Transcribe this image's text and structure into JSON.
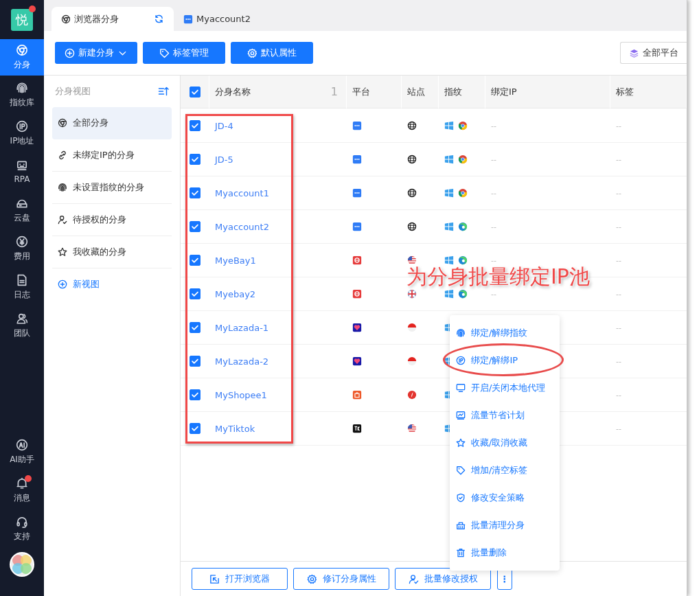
{
  "sidebar": {
    "logo": "悦",
    "logo_badge": true,
    "items": [
      {
        "label": "分身",
        "selected": true
      },
      {
        "label": "指纹库",
        "selected": false
      },
      {
        "label": "IP地址",
        "selected": false
      },
      {
        "label": "RPA",
        "selected": false
      },
      {
        "label": "云盘",
        "selected": false
      },
      {
        "label": "费用",
        "selected": false
      },
      {
        "label": "日志",
        "selected": false
      },
      {
        "label": "团队",
        "selected": false
      }
    ],
    "bottom_items": [
      {
        "label": "AI助手",
        "badge": false
      },
      {
        "label": "消息",
        "badge": true
      },
      {
        "label": "支持",
        "badge": false
      }
    ]
  },
  "tabs": [
    {
      "label": "浏览器分身",
      "selected": true,
      "refresh": true
    },
    {
      "label": "Myaccount2",
      "selected": false,
      "refresh": false
    }
  ],
  "toolbar": {
    "buttons": [
      {
        "label": "新建分身",
        "dropdown": true
      },
      {
        "label": "标签管理",
        "dropdown": false
      },
      {
        "label": "默认属性",
        "dropdown": false
      }
    ],
    "platform_filter": "全部平台"
  },
  "views": {
    "title": "分身视图",
    "items": [
      {
        "label": "全部分身",
        "selected": true
      },
      {
        "label": "未绑定IP的分身",
        "selected": false
      },
      {
        "label": "未设置指纹的分身",
        "selected": false
      },
      {
        "label": "待授权的分身",
        "selected": false
      },
      {
        "label": "我收藏的分身",
        "selected": false
      }
    ],
    "add_link": "新视图"
  },
  "table": {
    "all_checked": true,
    "columns": [
      {
        "label": "分身名称",
        "extra": "1"
      },
      {
        "label": "平台"
      },
      {
        "label": "站点"
      },
      {
        "label": "指纹"
      },
      {
        "label": "绑定IP"
      },
      {
        "label": "标签"
      }
    ],
    "rows": [
      {
        "checked": true,
        "name": "JD-4",
        "ip": "--",
        "tag": "--"
      },
      {
        "checked": true,
        "name": "JD-5",
        "ip": "--",
        "tag": "--"
      },
      {
        "checked": true,
        "name": "Myaccount1",
        "ip": "--",
        "tag": "--"
      },
      {
        "checked": true,
        "name": "Myaccount2",
        "ip": "--",
        "tag": "--"
      },
      {
        "checked": true,
        "name": "MyeBay1",
        "ip": "--",
        "tag": "--"
      },
      {
        "checked": true,
        "name": "Myebay2",
        "ip": "--",
        "tag": "--"
      },
      {
        "checked": true,
        "name": "MyLazada-1",
        "tag": "--"
      },
      {
        "checked": true,
        "name": "MyLazada-2",
        "tag": "--"
      },
      {
        "checked": true,
        "name": "MyShopee1",
        "tag": "--"
      },
      {
        "checked": true,
        "name": "MyTiktok",
        "tag": "--"
      }
    ]
  },
  "context_menu": {
    "items": [
      {
        "label": "绑定/解绑指纹",
        "highlighted": false
      },
      {
        "label": "绑定/解绑IP",
        "highlighted": true
      },
      {
        "label": "开启/关闭本地代理",
        "highlighted": false
      },
      {
        "label": "流量节省计划",
        "highlighted": false
      },
      {
        "label": "收藏/取消收藏",
        "highlighted": false
      },
      {
        "label": "增加/清空标签",
        "highlighted": false
      },
      {
        "label": "修改安全策略",
        "highlighted": false
      },
      {
        "label": "批量清理分身",
        "highlighted": false
      },
      {
        "label": "批量删除",
        "highlighted": false
      }
    ]
  },
  "annotation": {
    "callout": "为分身批量绑定IP池",
    "frame_around_names": true
  },
  "bottom_bar": {
    "buttons": [
      {
        "label": "打开浏览器"
      },
      {
        "label": "修订分身属性"
      },
      {
        "label": "批量修改授权"
      }
    ],
    "more": "⋮"
  }
}
